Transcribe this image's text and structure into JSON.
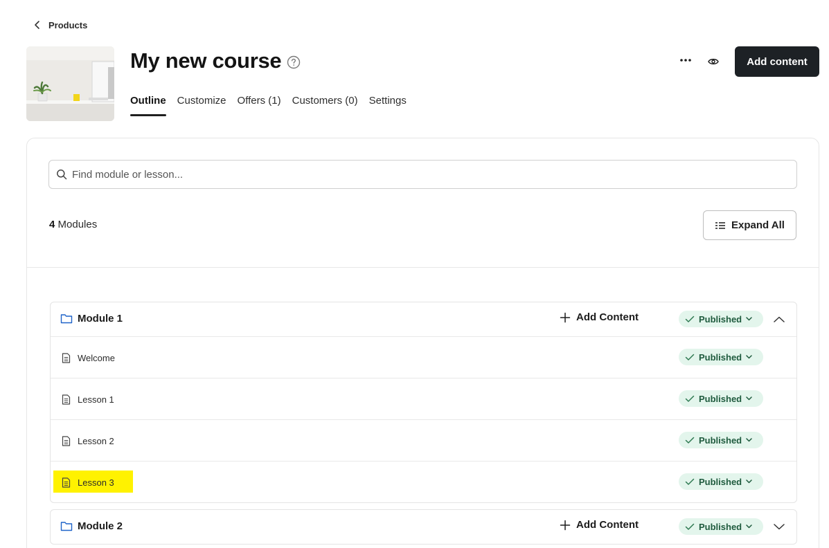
{
  "breadcrumb": {
    "label": "Products"
  },
  "course": {
    "title": "My new course",
    "tabs": [
      {
        "label": "Outline",
        "active": true
      },
      {
        "label": "Customize",
        "active": false
      },
      {
        "label": "Offers (1)",
        "active": false
      },
      {
        "label": "Customers (0)",
        "active": false
      },
      {
        "label": "Settings",
        "active": false
      }
    ]
  },
  "actions": {
    "add_content_label": "Add content"
  },
  "search": {
    "placeholder": "Find module or lesson..."
  },
  "modules_summary": {
    "count": "4",
    "label": "Modules"
  },
  "expand_all_label": "Expand All",
  "modules": [
    {
      "title": "Module 1",
      "add_label": "Add Content",
      "status": "Published",
      "expanded": true,
      "lessons": [
        {
          "title": "Welcome",
          "status": "Published",
          "highlighted": false
        },
        {
          "title": "Lesson 1",
          "status": "Published",
          "highlighted": false
        },
        {
          "title": "Lesson 2",
          "status": "Published",
          "highlighted": false
        },
        {
          "title": "Lesson 3",
          "status": "Published",
          "highlighted": true
        }
      ]
    },
    {
      "title": "Module 2",
      "add_label": "Add Content",
      "status": "Published",
      "expanded": false,
      "lessons": []
    }
  ],
  "colors": {
    "primary_button": "#1d2125",
    "published_pill_bg": "#e3f5ec",
    "published_pill_text": "#1f5b3e",
    "highlight": "#fff200"
  },
  "icons": {
    "back": "chevron-left-icon",
    "help": "question-circle-icon",
    "more": "more-horizontal-icon",
    "preview": "eye-icon",
    "search": "search-icon",
    "expand": "list-expand-icon",
    "module": "folder-icon",
    "lesson": "document-icon",
    "add": "plus-icon",
    "status": "check-icon",
    "dropdown": "chevron-down-icon",
    "collapse": "chevron-up-icon"
  }
}
